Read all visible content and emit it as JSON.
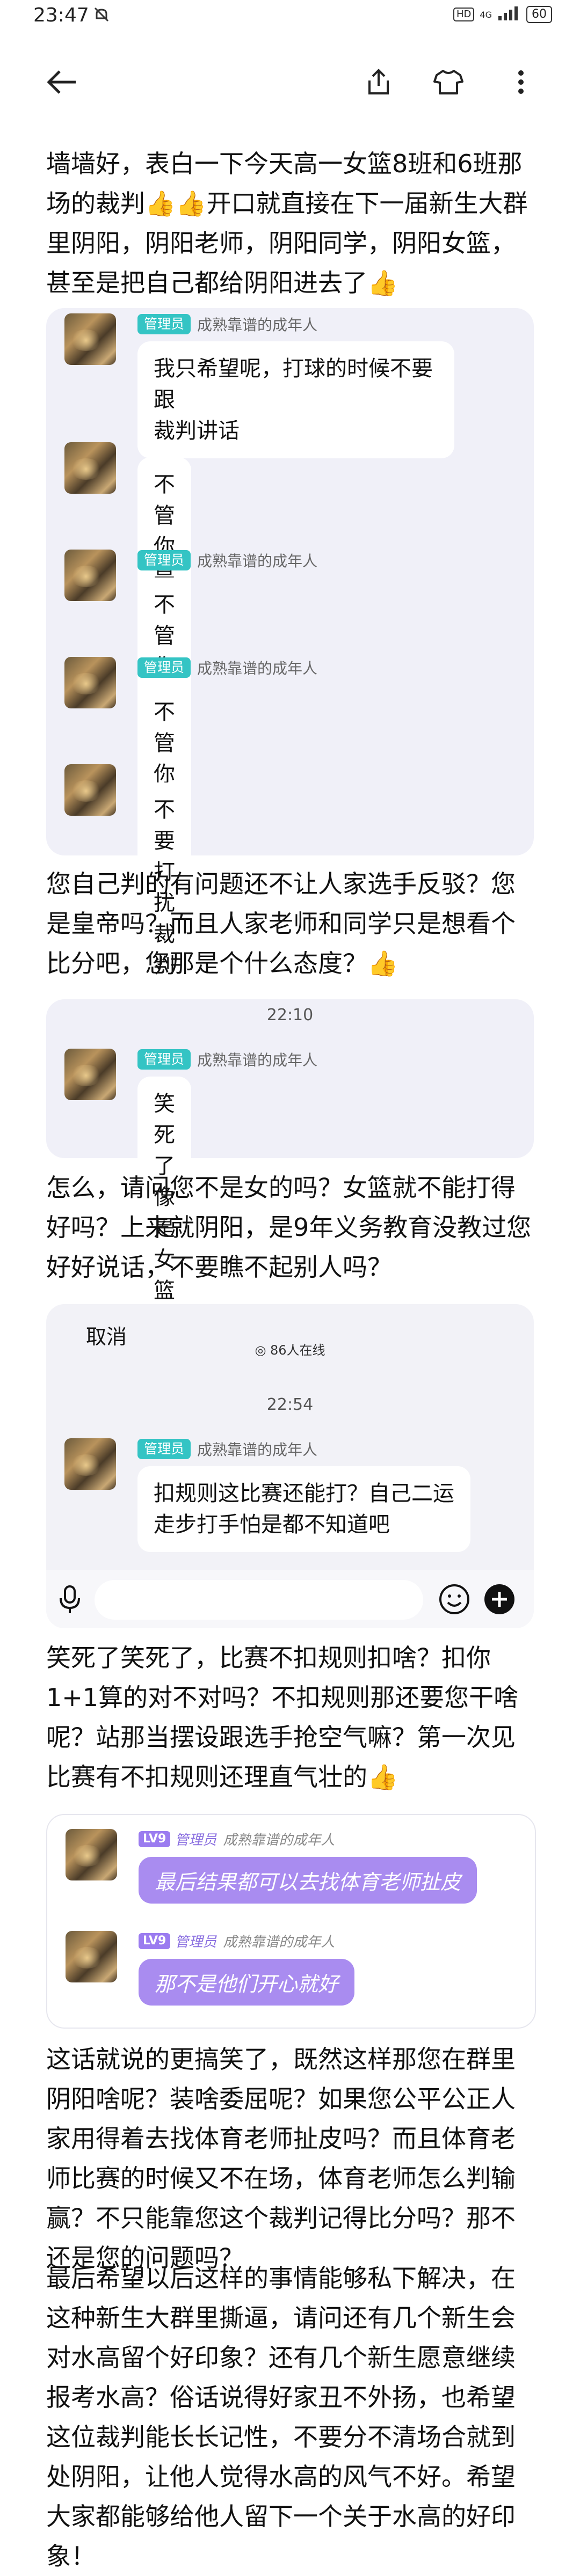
{
  "status": {
    "time": "23:47",
    "hd": "HD",
    "network": "4G",
    "battery": "60"
  },
  "topbar": {
    "back": "back",
    "share": "share",
    "shirt": "shirt",
    "more": "more"
  },
  "paragraphs": [
    "墙墙好，表白一下今天高一女篮8班和6班那场的裁判👍👍开口就直接在下一届新生大群里阴阳，阴阳老师，阴阳同学，阴阳女篮，甚至是把自己都给阴阳进去了👍",
    "您自己判的有问题还不让人家选手反驳？您是皇帝吗？而且人家老师和同学只是想看个比分吧，您那是个什么态度？👍",
    "怎么，请问您不是女的吗？女篮就不能打得好吗？上来就阴阳，是9年义务教育没教过您好好说话，不要瞧不起别人吗？",
    "笑死了笑死了，比赛不扣规则扣啥？扣你1+1算的对不对吗？不扣规则那还要您干啥呢？站那当摆设跟选手抢空气嘛？第一次见比赛有不扣规则还理直气壮的👍",
    "这话就说的更搞笑了，既然这样那您在群里阴阳啥呢？装啥委屈呢？如果您公平公正人家用得着去找体育老师扯皮吗？而且体育老师比赛的时候又不在场，体育老师怎么判输赢？不只能靠您这个裁判记得比分吗？那不还是您的问题吗？",
    "最后希望以后这样的事情能够私下解决，在这种新生大群里撕逼，请问还有几个新生会对水高留个好印象？还有几个新生愿意继续报考水高？俗话说得好家丑不外扬，也希望这位裁判能长长记性，不要分不清场合就到处阴阳，让他人觉得水高的风气不好。希望大家都能够给他人留下一个关于水高的好印象！"
  ],
  "chat1": {
    "badge": "管理员",
    "nick": "成熟靠谱的成年人",
    "messages": [
      "我只希望呢，打球的时候不要跟\n裁判讲话",
      "不管你是老师",
      "不管你是哪里的老师",
      "不管你是什么学生",
      "不要打扰裁判"
    ]
  },
  "chat2": {
    "time": "22:10",
    "badge": "管理员",
    "nick": "成熟靠谱的成年人",
    "message": "笑死了像是女篮能打多好一样"
  },
  "chat3": {
    "cancel": "取消",
    "online": "86人在线",
    "time": "22:54",
    "badge": "管理员",
    "nick": "成熟靠谱的成年人",
    "message": "扣规则这比赛还能打？自己二运\n走步打手怕是都不知道吧"
  },
  "chat4": {
    "lv": "LV9",
    "role": "管理员",
    "nick": "成熟靠谱的成年人",
    "messages": [
      "最后结果都可以去找体育老师扯皮",
      "那不是他们开心就好"
    ]
  }
}
